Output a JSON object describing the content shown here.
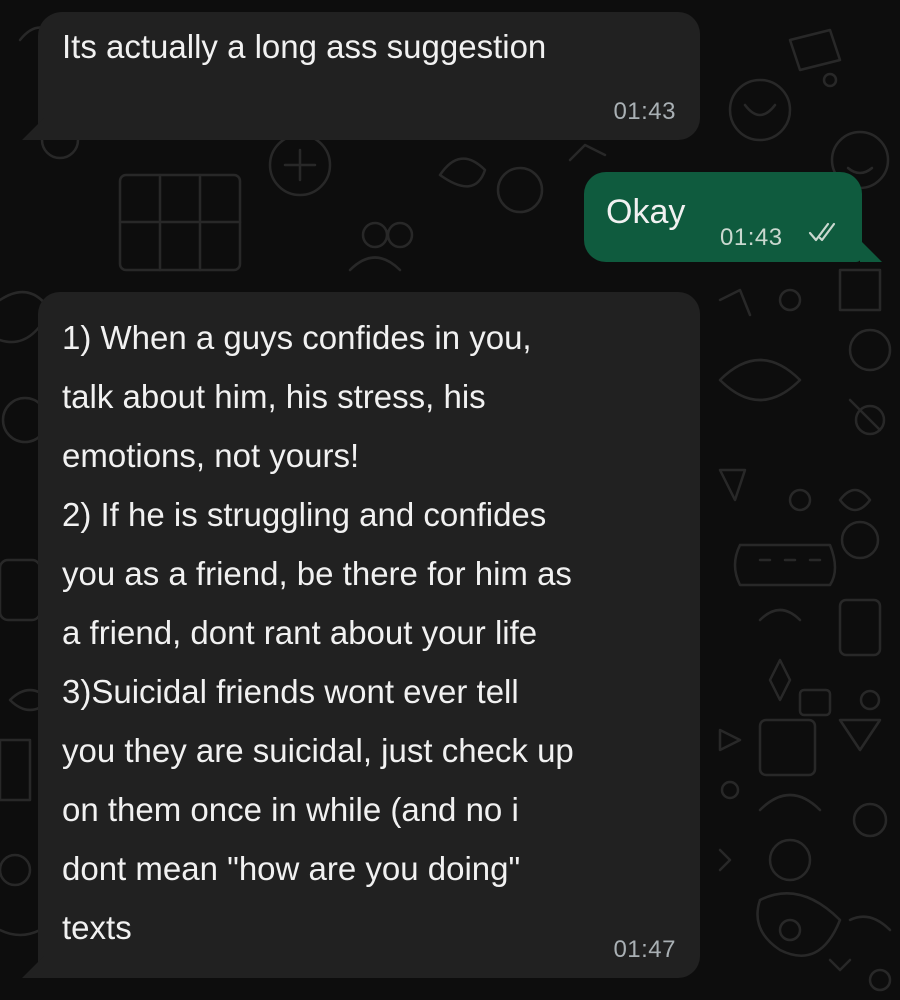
{
  "chat": {
    "messages": [
      {
        "direction": "incoming",
        "text": "Its actually a long ass suggestion",
        "time": "01:43"
      },
      {
        "direction": "outgoing",
        "text": "Okay",
        "time": "01:43",
        "status": "read",
        "status_icon": "double-check-icon"
      },
      {
        "direction": "incoming",
        "text": "1) When a guys confides in you,\ntalk about him, his stress, his\nemotions, not yours!\n2) If he is struggling and confides\nyou as a friend, be there for him as\na friend, dont rant about your life\n3)Suicidal friends wont ever tell\nyou they are suicidal, just check up\non them once in while (and no i\ndont mean \"how are you doing\"\ntexts",
        "time": "01:47"
      }
    ]
  },
  "colors": {
    "background": "#0d0d0d",
    "incoming_bubble": "#212121",
    "outgoing_bubble": "#0f5b3e",
    "text": "#f1f1f1",
    "timestamp": "#a9b0b4"
  }
}
